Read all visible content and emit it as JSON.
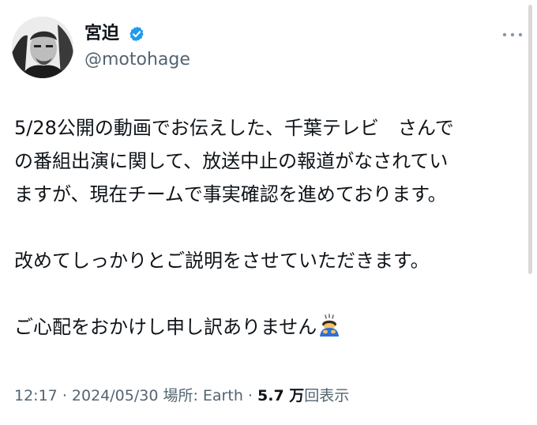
{
  "author": {
    "display_name": "宮迫",
    "handle": "@motohage",
    "verified_icon": "verified-badge-icon",
    "avatar_icon": "avatar-portrait"
  },
  "more_icon": "more-horizontal-icon",
  "tweet": {
    "lines": [
      "5/28公開の動画でお伝えした、千葉テレビ　さんで",
      "の番組出演に関して、放送中止の報道がなされてい",
      "ますが、現在チームで事実確認を進めております。",
      "改めてしっかりとご説明をさせていただきます。",
      "ご心配をおかけし申し訳ありません"
    ],
    "emoji_icon": "person-bowing-icon"
  },
  "meta": {
    "time": "12:17",
    "date": "2024/05/30",
    "location": "場所: Earth",
    "separator": "·",
    "views_count": "5.7 万",
    "views_label": "回表示"
  },
  "colors": {
    "text": "#0f1419",
    "secondary": "#536471",
    "verified": "#1d9bf0"
  }
}
